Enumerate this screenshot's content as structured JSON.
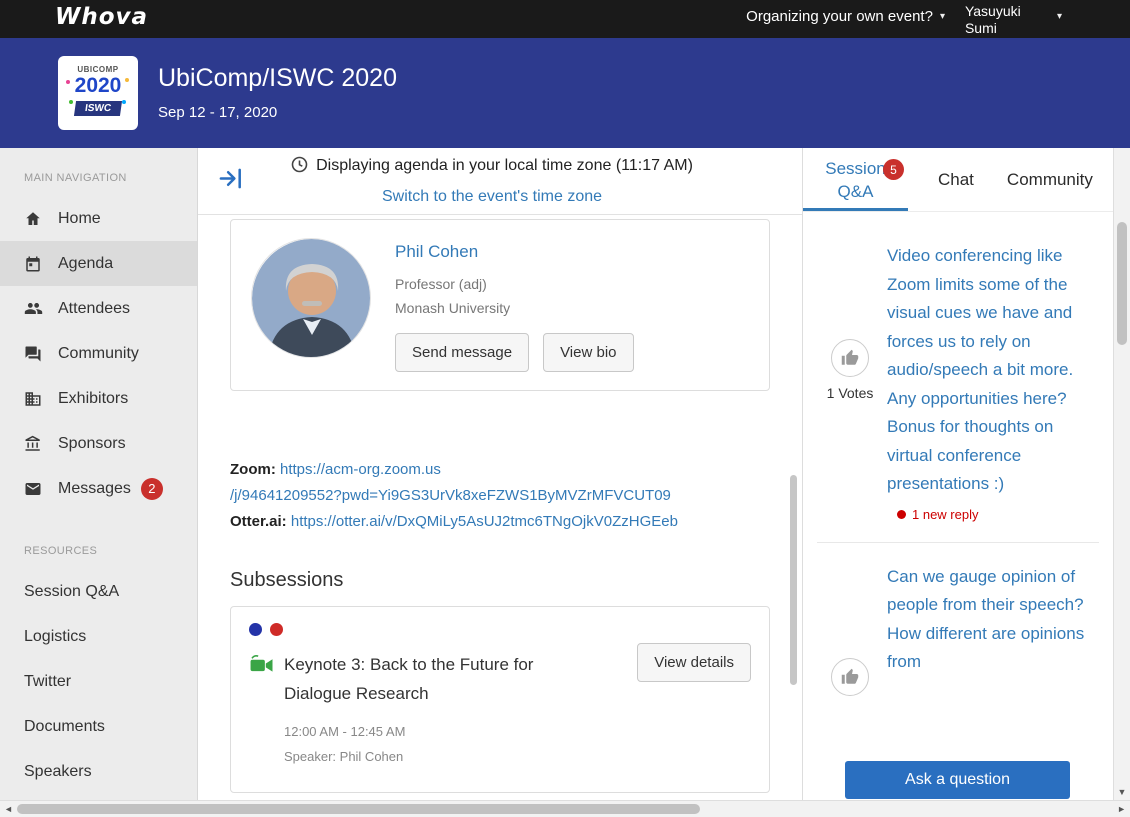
{
  "colors": {
    "banner_navy": "#2d3a8e",
    "link_blue": "#337ab7",
    "badge_red": "#c9302c",
    "button_blue": "#2a6fc0",
    "camera_green": "#3aa546"
  },
  "topbar": {
    "logo": "Whova",
    "organizer_link": "Organizing your own event?",
    "user_name": "Yasuyuki Sumi"
  },
  "banner": {
    "title": "UbiComp/ISWC 2020",
    "dates": "Sep 12 - 17, 2020",
    "logo": {
      "top": "UBICOMP",
      "year": "2020",
      "badge": "ISWC"
    }
  },
  "sidebar": {
    "main_label": "MAIN NAVIGATION",
    "main_items": [
      {
        "label": "Home"
      },
      {
        "label": "Agenda"
      },
      {
        "label": "Attendees"
      },
      {
        "label": "Community"
      },
      {
        "label": "Exhibitors"
      },
      {
        "label": "Sponsors"
      },
      {
        "label": "Messages",
        "badge": "2"
      }
    ],
    "resources_label": "RESOURCES",
    "resource_items": [
      {
        "label": "Session Q&A"
      },
      {
        "label": "Logistics"
      },
      {
        "label": "Twitter"
      },
      {
        "label": "Documents"
      },
      {
        "label": "Speakers"
      }
    ]
  },
  "main": {
    "timezone_notice": "Displaying agenda in your local time zone (11:17 AM)",
    "timezone_link": "Switch to the event's time zone",
    "speaker": {
      "name": "Phil Cohen",
      "title": "Professor (adj)",
      "affiliation": "Monash University",
      "send_message": "Send message",
      "view_bio": "View bio"
    },
    "links": {
      "zoom_label": "Zoom:",
      "zoom_url": "https://acm-org.zoom.us\n/j/94641209552?pwd=Yi9GS3UrVk8xeFZWS1ByMVZrMFVCUT09",
      "otter_label": "Otter.ai:",
      "otter_url": "https://otter.ai/v/DxQMiLy5AsUJ2tmc6TNgOjkV0ZzHGEeb"
    },
    "subsessions": {
      "heading": "Subsessions",
      "card": {
        "title": "Keynote 3: Back to the Future for Dialogue Research",
        "view_details": "View details",
        "time": "12:00 AM - 12:45 AM",
        "speaker": "Speaker: Phil Cohen"
      }
    }
  },
  "qa": {
    "tabs": [
      {
        "label": "Session Q&A",
        "badge": "5"
      },
      {
        "label": "Chat"
      },
      {
        "label": "Community"
      }
    ],
    "questions": [
      {
        "votes": "1",
        "votes_label": "Votes",
        "text": "Video conferencing like Zoom limits some of the visual cues we have and forces us to rely on audio/speech a bit more. Any opportunities here? Bonus for thoughts on virtual conference presentations :)",
        "new_reply": "1 new reply"
      },
      {
        "text": "Can we gauge opinion of people from their speech? How different are opinions from"
      }
    ],
    "ask_button": "Ask a question"
  }
}
